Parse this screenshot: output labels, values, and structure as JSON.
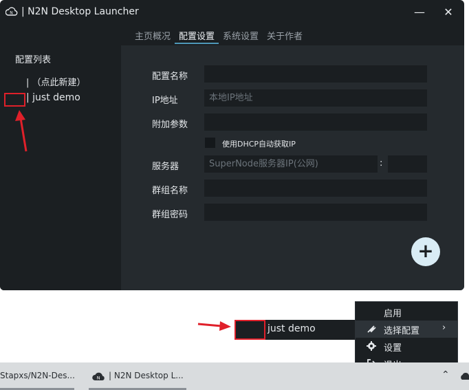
{
  "window": {
    "title": "| N2N Desktop Launcher",
    "minimize_glyph": "—",
    "close_glyph": "✕"
  },
  "tabs": [
    {
      "label": "主页概况",
      "active": false
    },
    {
      "label": "配置设置",
      "active": true
    },
    {
      "label": "系统设置",
      "active": false
    },
    {
      "label": "关于作者",
      "active": false
    }
  ],
  "sidebar": {
    "title": "配置列表",
    "new_item": "|  （点此新建）",
    "items": [
      "| just demo"
    ]
  },
  "form": {
    "config_name_label": "配置名称",
    "config_name_value": "",
    "ip_label": "IP地址",
    "ip_placeholder": "本地IP地址",
    "extra_label": "附加参数",
    "extra_value": "",
    "dhcp_label": "使用DHCP自动获取IP",
    "server_label": "服务器",
    "server_placeholder": "SuperNode服务器IP(公网)",
    "server_colon": ":",
    "port_value": "",
    "group_name_label": "群组名称",
    "group_name_value": "",
    "group_pwd_label": "群组密码",
    "group_pwd_value": "",
    "add_glyph": "+"
  },
  "tray_popup": {
    "item_label": "just demo"
  },
  "context_menu": {
    "items": [
      {
        "label": "启用",
        "icon": "none"
      },
      {
        "label": "选择配置",
        "icon": "plug-icon",
        "submenu": "›"
      },
      {
        "label": "设置",
        "icon": "gear-icon"
      },
      {
        "label": "退出",
        "icon": "exit-icon"
      }
    ]
  },
  "taskbar": {
    "items": [
      {
        "label": "Stapxs/N2N-Des..."
      },
      {
        "label": "| N2N Desktop L..."
      }
    ],
    "tray_up_glyph": "⌃"
  },
  "colors": {
    "window_bg": "#1b1f22",
    "panel_bg": "#252a2e",
    "accent": "#4e98b8",
    "annotation_red": "#e0202a"
  }
}
